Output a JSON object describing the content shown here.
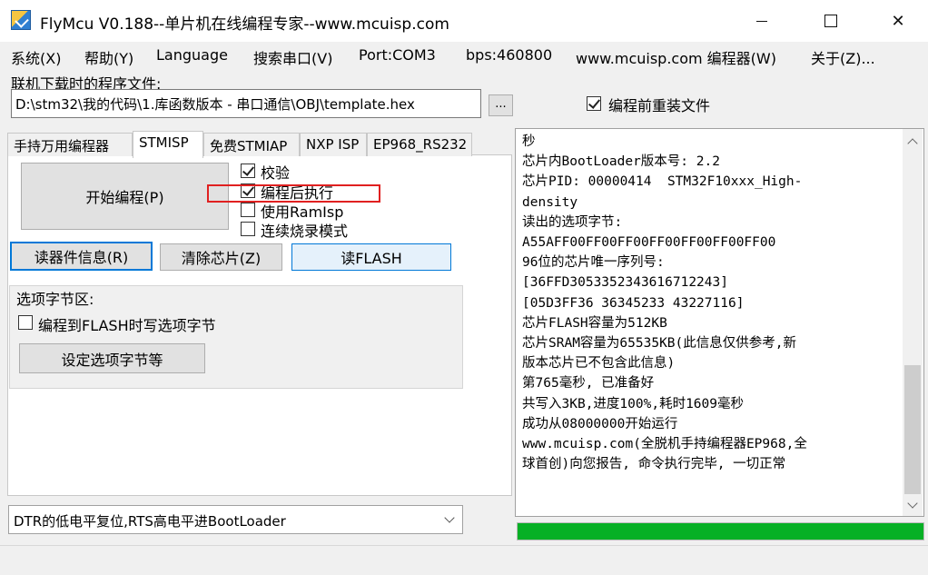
{
  "window": {
    "title": "FlyMcu V0.188--单片机在线编程专家--www.mcuisp.com",
    "controls": {
      "minimize": "—",
      "maximize": "□",
      "close": "✕"
    }
  },
  "menu": [
    "系统(X)",
    "帮助(Y)",
    "Language",
    "搜索串口(V)",
    "Port:COM3",
    "bps:460800",
    "www.mcuisp.com 编程器(W)",
    "关于(Z)..."
  ],
  "file": {
    "label": "联机下载时的程序文件:",
    "path": "D:\\stm32\\我的代码\\1.库函数版本 - 串口通信\\OBJ\\template.hex",
    "browse_label": "...",
    "reload_label": "编程前重装文件",
    "reload_checked": true
  },
  "tabs": [
    "手持万用编程器",
    "STMISP",
    "免费STMIAP",
    "NXP ISP",
    "EP968_RS232"
  ],
  "active_tab": "STMISP",
  "stmisp": {
    "start_button": "开始编程(P)",
    "options": [
      {
        "label": "校验",
        "checked": true
      },
      {
        "label": "编程后执行",
        "checked": true
      },
      {
        "label": "使用RamIsp",
        "checked": false
      },
      {
        "label": "连续烧录模式",
        "checked": false
      }
    ],
    "read_info_button": "读器件信息(R)",
    "erase_button": "清除芯片(Z)",
    "read_flash_button": "读FLASH",
    "option_bytes": {
      "title": "选项字节区:",
      "write_label": "编程到FLASH时写选项字节",
      "write_checked": false,
      "set_button": "设定选项字节等"
    },
    "dtr_mode": "DTR的低电平复位,RTS高电平进BootLoader"
  },
  "log_lines": [
    "秒",
    "芯片内BootLoader版本号: 2.2",
    "芯片PID: 00000414  STM32F10xxx_High-",
    "density",
    "读出的选项字节:",
    "A55AFF00FF00FF00FF00FF00FF00FF00",
    "96位的芯片唯一序列号:",
    "[36FFD3053352343616712243]",
    "[05D3FF36 36345233 43227116]",
    "芯片FLASH容量为512KB",
    "芯片SRAM容量为65535KB(此信息仅供参考,新",
    "版本芯片已不包含此信息)",
    "第765毫秒, 已准备好",
    "共写入3KB,进度100%,耗时1609毫秒",
    "成功从08000000开始运行",
    "www.mcuisp.com(全脱机手持编程器EP968,全",
    "球首创)向您报告, 命令执行完毕, 一切正常"
  ],
  "progress": {
    "percent": 100,
    "color": "#06b025"
  },
  "colors": {
    "highlight_box": "#e02020",
    "focus_border": "#0078d7"
  }
}
